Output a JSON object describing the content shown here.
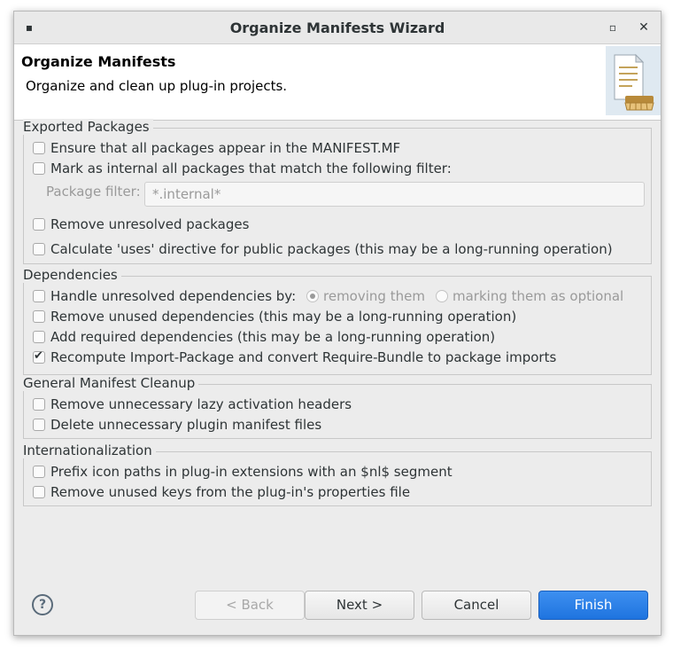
{
  "window": {
    "title": "Organize Manifests Wizard"
  },
  "header": {
    "title": "Organize Manifests",
    "description": "Organize and clean up plug-in projects."
  },
  "groups": {
    "exported": {
      "label": "Exported Packages",
      "items": [
        {
          "label": "Ensure that all packages appear in the MANIFEST.MF",
          "checked": false
        },
        {
          "label": "Mark as internal all packages that match the following filter:",
          "checked": false
        },
        {
          "label": "Remove unresolved packages",
          "checked": false
        },
        {
          "label": "Calculate 'uses' directive for public packages (this may be a long-running operation)",
          "checked": false
        }
      ],
      "filter": {
        "label": "Package filter:",
        "value": "*.internal*"
      }
    },
    "dependencies": {
      "label": "Dependencies",
      "items": [
        {
          "label": "Handle unresolved dependencies by:",
          "checked": false
        },
        {
          "label": "Remove unused dependencies (this may be a long-running operation)",
          "checked": false
        },
        {
          "label": "Add required dependencies (this may be a long-running operation)",
          "checked": false
        },
        {
          "label": "Recompute Import-Package and convert Require-Bundle to package imports",
          "checked": true
        }
      ],
      "radios": [
        {
          "label": "removing them",
          "selected": true
        },
        {
          "label": "marking them as optional",
          "selected": false
        }
      ]
    },
    "cleanup": {
      "label": "General Manifest Cleanup",
      "items": [
        {
          "label": "Remove unnecessary lazy activation headers",
          "checked": false
        },
        {
          "label": "Delete unnecessary plugin manifest files",
          "checked": false
        }
      ]
    },
    "i18n": {
      "label": "Internationalization",
      "items": [
        {
          "label": "Prefix icon paths in plug-in extensions with an $nl$ segment",
          "checked": false
        },
        {
          "label": "Remove unused keys from the plug-in's properties file",
          "checked": false
        }
      ]
    }
  },
  "buttons": {
    "help": "?",
    "back": "< Back",
    "next": "Next >",
    "cancel": "Cancel",
    "finish": "Finish"
  },
  "colors": {
    "accent": "#2a7ce4",
    "background": "#ececec"
  }
}
